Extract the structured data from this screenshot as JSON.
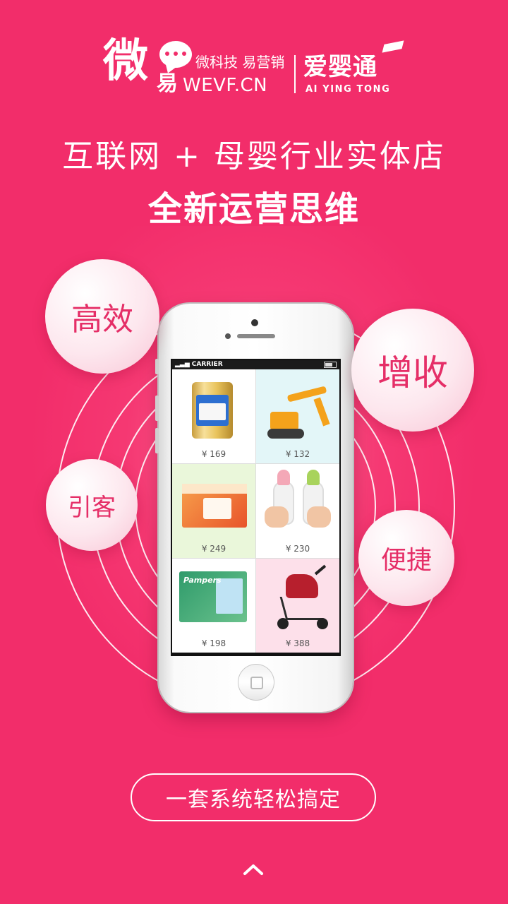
{
  "header": {
    "logo_wei": "微",
    "logo_yi": "易",
    "slogan": "微科技 易营销",
    "domain": "WEVF.CN",
    "brand_cn": "爱婴通",
    "brand_en": "AI YING TONG"
  },
  "headline": "互联网 + 母婴行业实体店",
  "subheadline": "全新运营思维",
  "features": {
    "efficient": "高效",
    "revenue": "增收",
    "attract": "引客",
    "convenient": "便捷"
  },
  "phone": {
    "carrier": "CARRIER",
    "products": [
      {
        "price": "¥ 169"
      },
      {
        "price": "¥ 132"
      },
      {
        "price": "¥ 249"
      },
      {
        "price": "¥ 230"
      },
      {
        "price": "¥ 198"
      },
      {
        "price": "¥ 388"
      }
    ],
    "pampers_text": "Pampers"
  },
  "cta": "一套系统轻松搞定",
  "icons": {
    "up": "chevron-up-icon",
    "chat": "chat-bubble-icon"
  },
  "colors": {
    "background": "#f22d6a",
    "accent_text": "#e52e67"
  }
}
